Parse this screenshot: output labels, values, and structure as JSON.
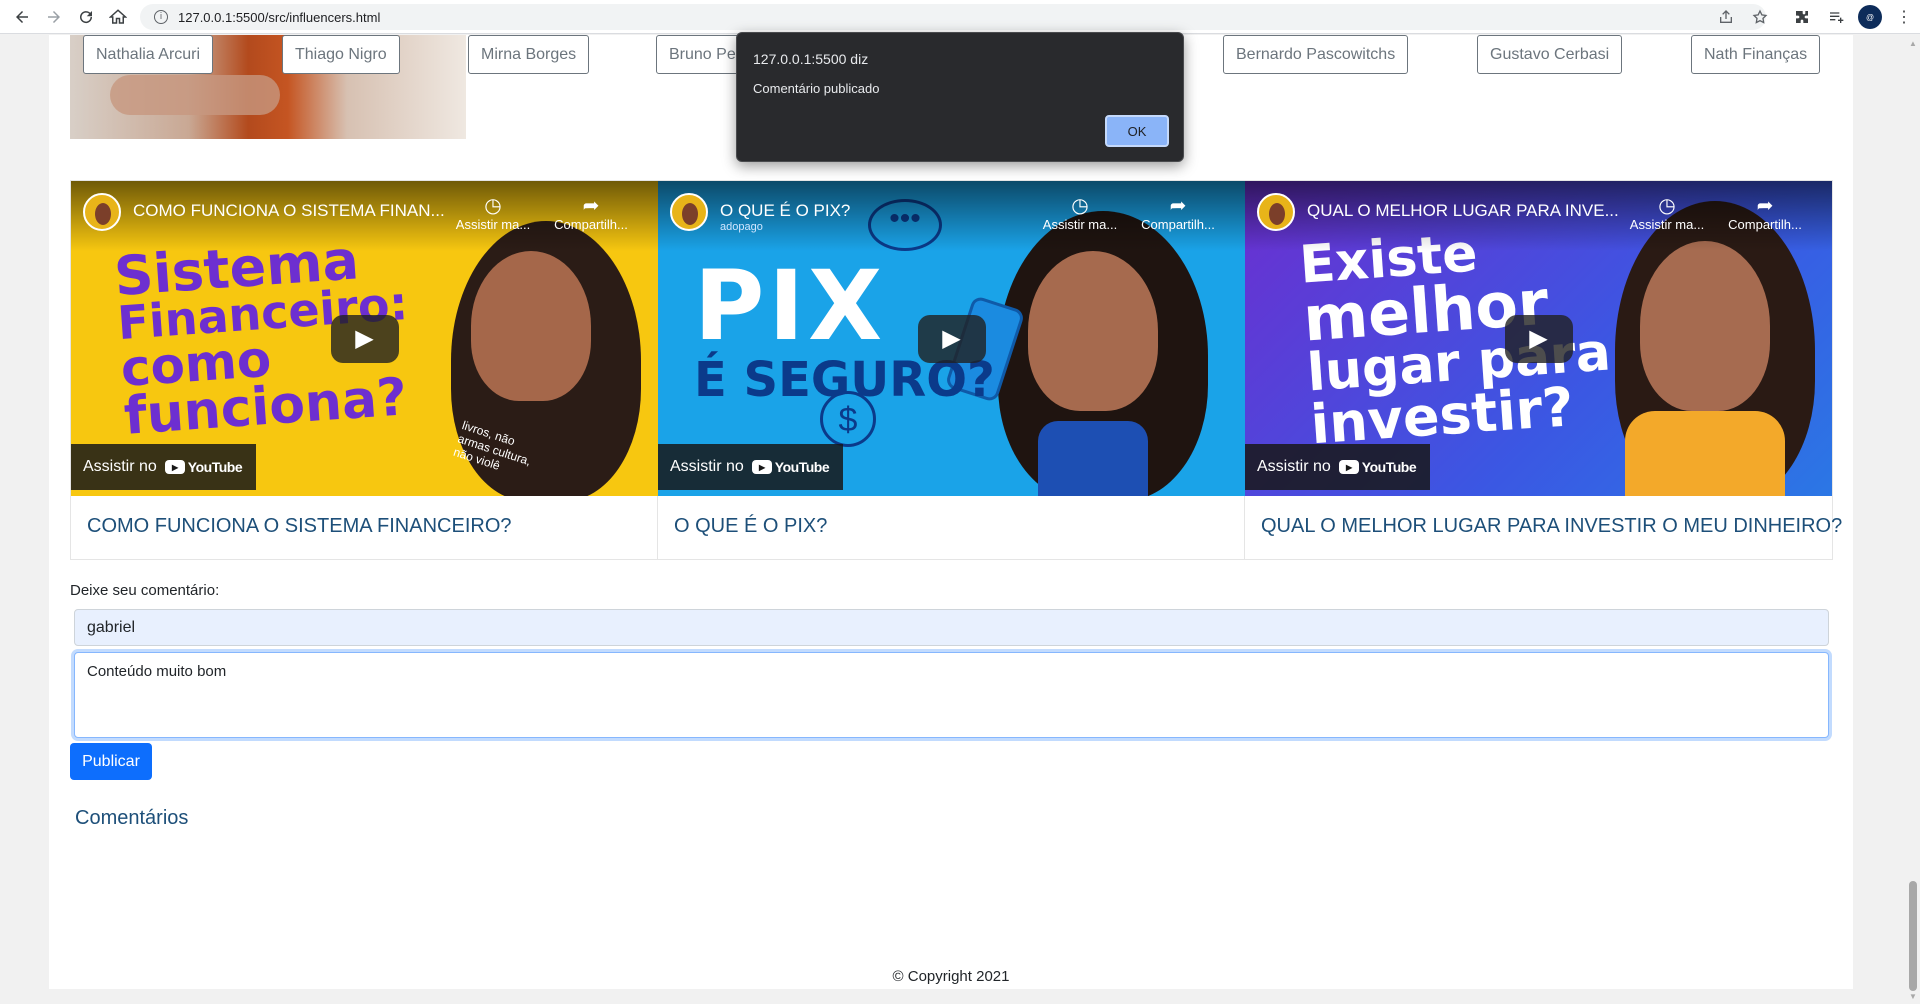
{
  "browser": {
    "url": "127.0.0.1:5500/src/influencers.html",
    "avatar_text": "@"
  },
  "influencers": [
    "Nathalia Arcuri",
    "Thiago Nigro",
    "Mirna Borges",
    "Bruno Pe",
    "Bernardo Pascowitchs",
    "Gustavo Cerbasi",
    "Nath Finanças"
  ],
  "videos": [
    {
      "overlay_title": "COMO FUNCIONA O SISTEMA FINAN...",
      "caption": "COMO FUNCIONA O SISTEMA FINANCEIRO?",
      "thumb_text": [
        "Sistema",
        "Financeiro:",
        "como",
        "funciona?"
      ],
      "shirt_text": "livros, não armas cultura, não violê"
    },
    {
      "overlay_title": "O QUE É O PIX?",
      "caption": "O QUE É O PIX?",
      "channel_sub": "adopago",
      "thumb_text": [
        "PIX",
        "É SEGURO?"
      ]
    },
    {
      "overlay_title": "QUAL O MELHOR LUGAR PARA INVE...",
      "caption": "QUAL O MELHOR LUGAR PARA INVESTIR O MEU DINHEIRO?",
      "thumb_text": [
        "Existe",
        "melhor",
        "lugar para",
        "investir?"
      ]
    }
  ],
  "player": {
    "watch_later": "Assistir ma...",
    "share": "Compartilh...",
    "watch_on": "Assistir no",
    "yt_brand": "YouTube"
  },
  "comment_form": {
    "label": "Deixe seu comentário:",
    "name_value": "gabriel",
    "comment_value": "Conteúdo muito bom",
    "publish_label": "Publicar"
  },
  "comments_title": "Comentários",
  "copyright": "© Copyright 2021",
  "dialog": {
    "title": "127.0.0.1:5500 diz",
    "message": "Comentário publicado",
    "ok_label": "OK"
  },
  "colors": {
    "primary": "#0d6efd",
    "heading": "#1d4f79",
    "dialog_bg": "#292a2d",
    "ok_button": "#8ab4f8"
  }
}
